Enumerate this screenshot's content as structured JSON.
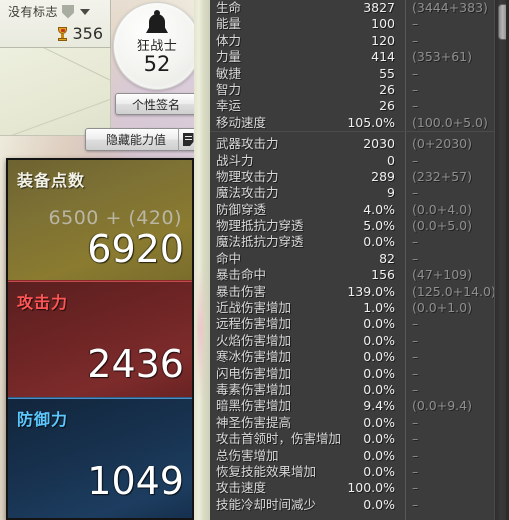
{
  "left_panel": {
    "guild": {
      "label": "没有标志",
      "shield_icon": "shield-icon",
      "dropdown_icon": "chevron-down-icon",
      "trophy_icon": "trophy-icon",
      "trophy_count": "356"
    },
    "character": {
      "class_icon": "berserker-helm-icon",
      "class_name": "狂战士",
      "level": "52"
    },
    "buttons": {
      "signature": "个性签名",
      "hide_stats": "隐藏能力值",
      "hide_stats_icon": "note-document-icon"
    },
    "panels": [
      {
        "id": "gear-score",
        "title": "装备点数",
        "sub": "6500 + (420)",
        "value": "6920",
        "color": "#7d7134",
        "title_color": "#f2f1e6"
      },
      {
        "id": "attack-power",
        "title": "攻击力",
        "sub": "",
        "value": "2436",
        "color": "#6d2424",
        "title_color": "#ff5555"
      },
      {
        "id": "defense-power",
        "title": "防御力",
        "sub": "",
        "value": "1049",
        "color": "#17314e",
        "title_color": "#5cc8ff"
      }
    ]
  },
  "stats_panel": {
    "scrollbar": {
      "thumb_position": "top"
    },
    "groups": [
      {
        "id": "base-attributes",
        "rows": [
          {
            "name": "生命",
            "value": "3827",
            "detail": "(3444+383)"
          },
          {
            "name": "能量",
            "value": "100",
            "detail": "–"
          },
          {
            "name": "体力",
            "value": "120",
            "detail": "–"
          },
          {
            "name": "力量",
            "value": "414",
            "detail": "(353+61)"
          },
          {
            "name": "敏捷",
            "value": "55",
            "detail": "–"
          },
          {
            "name": "智力",
            "value": "26",
            "detail": "–"
          },
          {
            "name": "幸运",
            "value": "26",
            "detail": "–"
          },
          {
            "name": "移动速度",
            "value": "105.0%",
            "detail": "(100.0+5.0)"
          }
        ]
      },
      {
        "id": "combat-attributes",
        "rows": [
          {
            "name": "武器攻击力",
            "value": "2030",
            "detail": "(0+2030)"
          },
          {
            "name": "战斗力",
            "value": "0",
            "detail": "–"
          },
          {
            "name": "物理攻击力",
            "value": "289",
            "detail": "(232+57)"
          },
          {
            "name": "魔法攻击力",
            "value": "9",
            "detail": "–"
          },
          {
            "name": "防御穿透",
            "value": "4.0%",
            "detail": "(0.0+4.0)"
          },
          {
            "name": "物理抵抗力穿透",
            "value": "5.0%",
            "detail": "(0.0+5.0)"
          },
          {
            "name": "魔法抵抗力穿透",
            "value": "0.0%",
            "detail": "–"
          },
          {
            "name": "命中",
            "value": "82",
            "detail": "–"
          },
          {
            "name": "暴击命中",
            "value": "156",
            "detail": "(47+109)"
          },
          {
            "name": "暴击伤害",
            "value": "139.0%",
            "detail": "(125.0+14.0)"
          },
          {
            "name": "近战伤害增加",
            "value": "1.0%",
            "detail": "(0.0+1.0)"
          },
          {
            "name": "远程伤害增加",
            "value": "0.0%",
            "detail": "–"
          },
          {
            "name": "火焰伤害增加",
            "value": "0.0%",
            "detail": "–"
          },
          {
            "name": "寒冰伤害增加",
            "value": "0.0%",
            "detail": "–"
          },
          {
            "name": "闪电伤害增加",
            "value": "0.0%",
            "detail": "–"
          },
          {
            "name": "毒素伤害增加",
            "value": "0.0%",
            "detail": "–"
          },
          {
            "name": "暗黑伤害增加",
            "value": "9.4%",
            "detail": "(0.0+9.4)"
          },
          {
            "name": "神圣伤害提高",
            "value": "0.0%",
            "detail": "–"
          },
          {
            "name": "攻击首领时，伤害增加",
            "value": "0.0%",
            "detail": "–"
          },
          {
            "name": "总伤害增加",
            "value": "0.0%",
            "detail": "–"
          },
          {
            "name": "恢复技能效果增加",
            "value": "0.0%",
            "detail": "–"
          },
          {
            "name": "攻击速度",
            "value": "100.0%",
            "detail": "–"
          },
          {
            "name": "技能冷却时间减少",
            "value": "0.0%",
            "detail": "–"
          }
        ]
      }
    ]
  }
}
